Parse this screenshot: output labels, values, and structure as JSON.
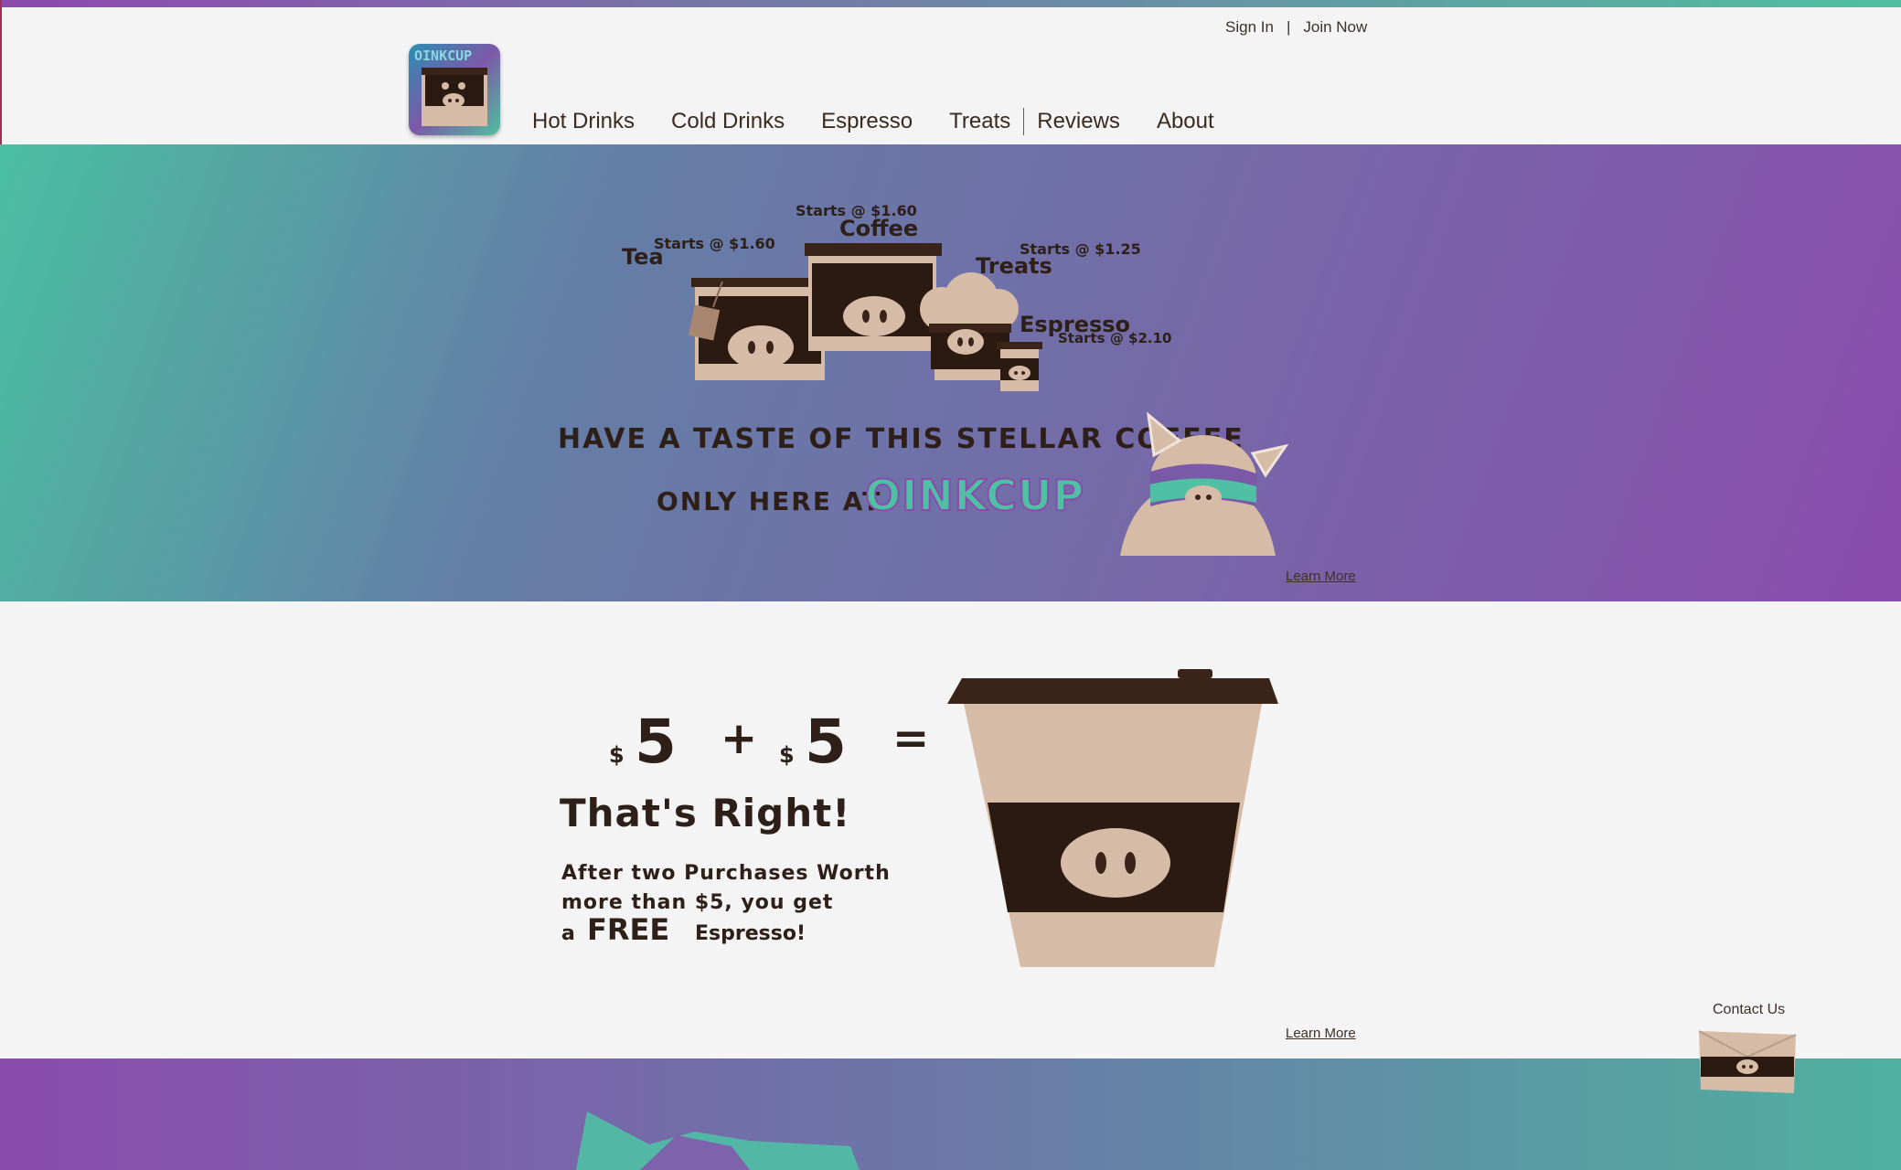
{
  "header": {
    "sign_in": "Sign In",
    "separator": "|",
    "join_now": "Join Now",
    "logo_text": "OINKCUP"
  },
  "nav": {
    "items": [
      "Hot Drinks",
      "Cold Drinks",
      "Espresso",
      "Treats",
      "Reviews",
      "About"
    ]
  },
  "hero": {
    "products": [
      {
        "name": "Tea",
        "price": "Starts @ $1.60"
      },
      {
        "name": "Coffee",
        "price": "Starts @ $1.60"
      },
      {
        "name": "Treats",
        "price": "Starts @ $1.25"
      },
      {
        "name": "Espresso",
        "price": "Starts @ $2.10"
      }
    ],
    "tagline_line1": "HAVE A TASTE OF THIS STELLAR COFFEE",
    "tagline_line2": "ONLY HERE AT",
    "brand": "OINKCUP",
    "learn_more": "Learn More"
  },
  "promo": {
    "equation_left": "5",
    "equation_plus": "+",
    "equation_right": "5",
    "equation_equals": "=",
    "currency": "$",
    "headline": "That's Right!",
    "line1": "After two Purchases Worth",
    "line2": "more than $5, you get",
    "line3_prefix": "a",
    "line3_free": "FREE",
    "line3_suffix": "Espresso!",
    "learn_more": "Learn More"
  },
  "contact": {
    "label": "Contact Us"
  },
  "colors": {
    "brown_dark": "#3a2419",
    "brown_light": "#d6bba7",
    "teal": "#4abfa1",
    "purple": "#8a4cac"
  }
}
